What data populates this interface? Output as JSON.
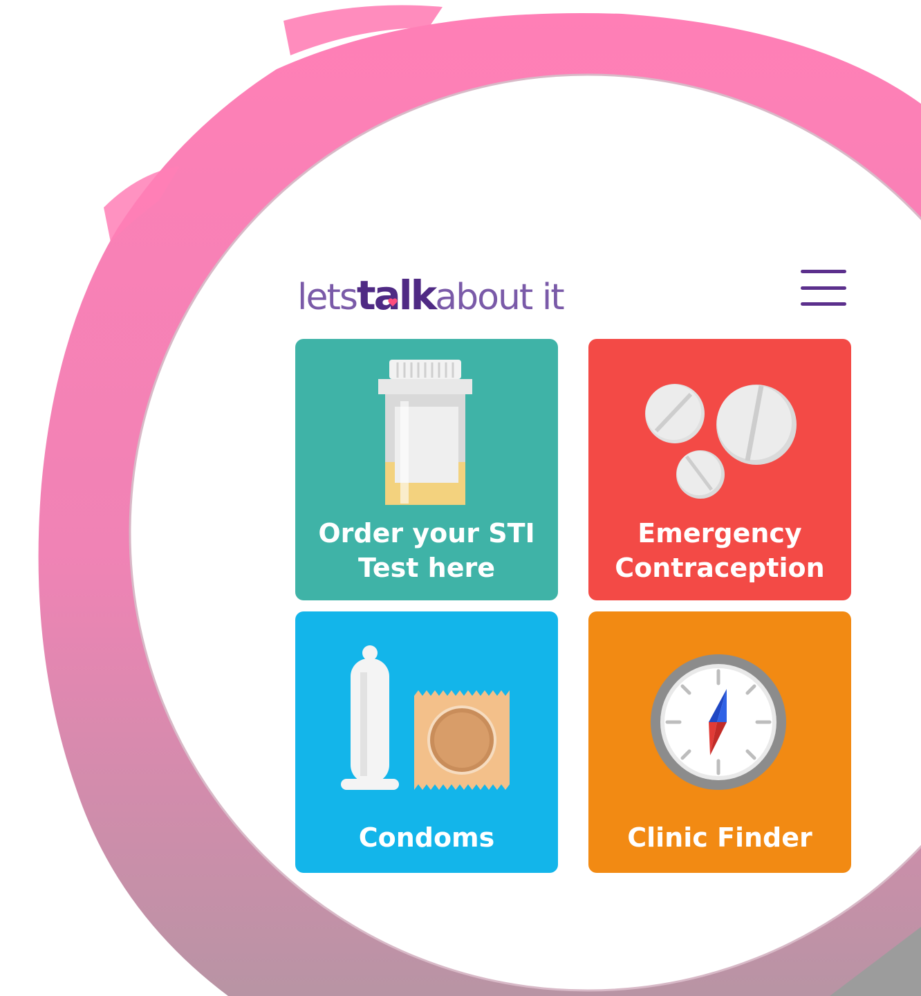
{
  "logo": {
    "lets": "lets",
    "talk": "talk",
    "about": "about it"
  },
  "colors": {
    "pink_frame": "#f77fb7",
    "purple": "#5b2f8c",
    "sti_tile": "#3fb3a7",
    "emergency_tile": "#f34a46",
    "condoms_tile": "#13b5ea",
    "clinic_tile": "#f28a13"
  },
  "tiles": [
    {
      "label_line1": "Order your STI",
      "label_line2": "Test here",
      "icon": "urine-sample-jar-icon"
    },
    {
      "label_line1": "Emergency",
      "label_line2": "Contraception",
      "icon": "pills-icon"
    },
    {
      "label": "Condoms",
      "icon": "condom-icon"
    },
    {
      "label": "Clinic Finder",
      "icon": "compass-icon"
    }
  ],
  "menu": {
    "icon": "hamburger-menu-icon"
  }
}
